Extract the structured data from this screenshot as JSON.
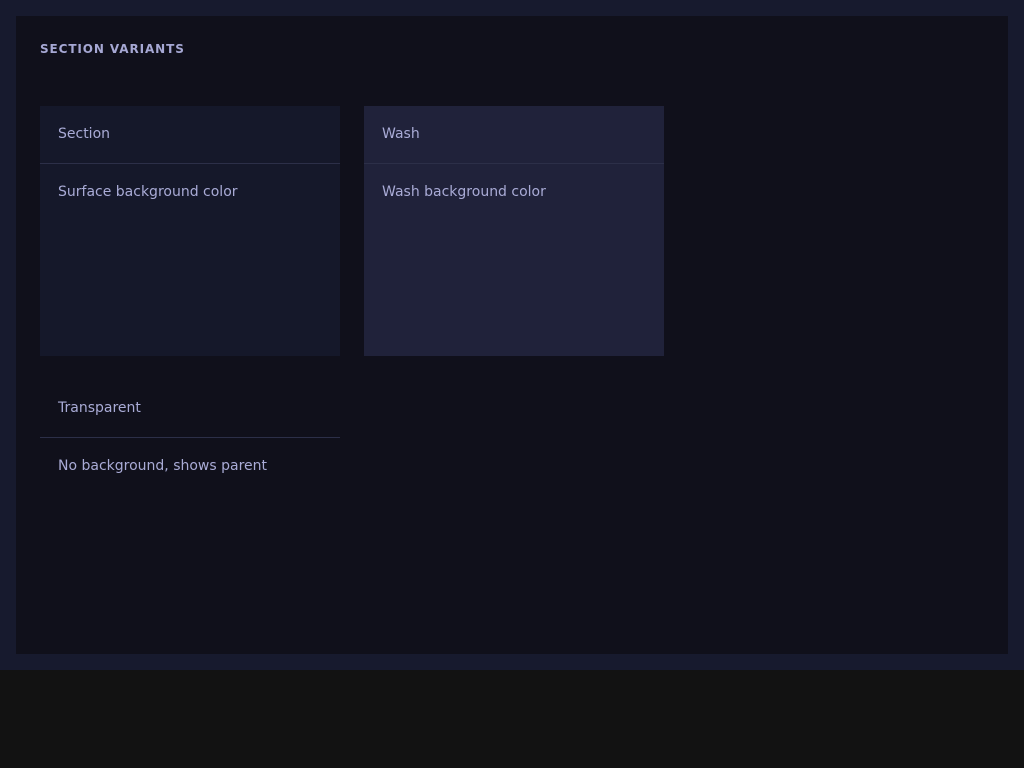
{
  "page": {
    "title": "SECTION VARIANTS"
  },
  "variants": [
    {
      "header": "Section",
      "body": "Surface background color"
    },
    {
      "header": "Wash",
      "body": "Wash background color"
    },
    {
      "header": "Transparent",
      "body": "No background, shows parent"
    }
  ],
  "colors": {
    "page_background": "#121212",
    "outer_frame": "#171a2e",
    "panel_background": "#10101b",
    "surface": "#15182a",
    "wash": "#20223a",
    "text": "#a9abd6",
    "divider": "#2c2f48"
  }
}
